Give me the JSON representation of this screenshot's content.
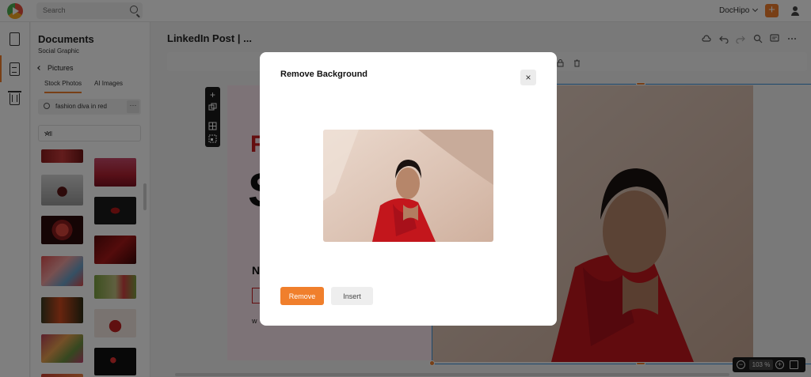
{
  "topbar": {
    "search_placeholder": "Search",
    "account_label": "DocHipo",
    "plus_label": "+"
  },
  "panel": {
    "title": "Documents",
    "subtitle": "Social Graphic",
    "back_label": "Pictures",
    "tabs": [
      {
        "label": "Stock Photos",
        "active": true
      },
      {
        "label": "AI Images",
        "active": false
      }
    ],
    "search_value": "fashion diva in red",
    "more_label": "···",
    "filter_value": "All"
  },
  "editor": {
    "title": "LinkedIn Post | ...",
    "canvas_letters": {
      "f": "F",
      "s": "S",
      "n": "N",
      "w": "w"
    },
    "zoom": "103 %",
    "zoom_out": "−",
    "zoom_in": "+"
  },
  "modal": {
    "title": "Remove Background",
    "close_label": "×",
    "remove_label": "Remove",
    "insert_label": "Insert"
  },
  "colors": {
    "accent": "#f07f2c",
    "selection": "#3b90d8",
    "brand_red": "#c81a1f"
  }
}
